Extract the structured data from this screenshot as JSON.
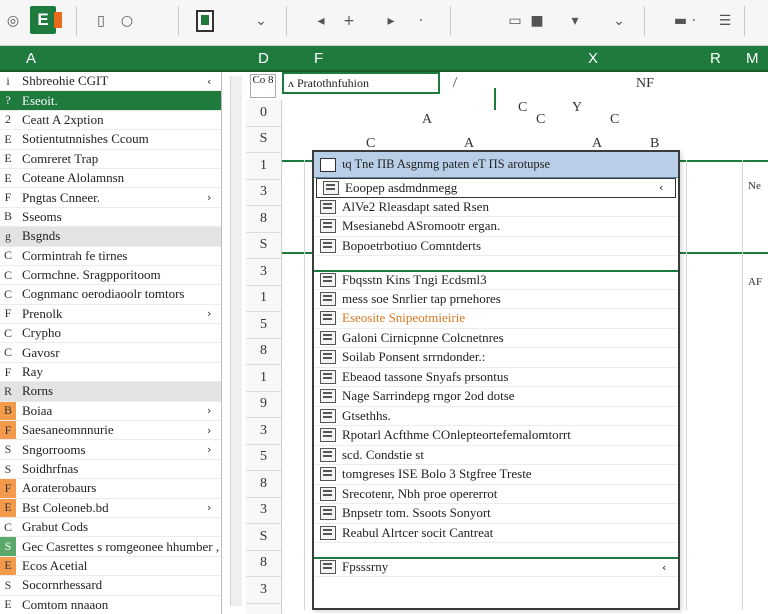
{
  "toolbar": {
    "logo": "E",
    "icons": [
      "settings-gear-icon",
      "phone-icon",
      "chevron-down-icon",
      "arrow-left-icon",
      "add-icon",
      "link-icon",
      "document-icon",
      "arrow-down-icon",
      "dash-icon",
      "menu-icon"
    ]
  },
  "column_headers": [
    "A",
    "D",
    "F",
    "X",
    "R",
    "M"
  ],
  "sidemenu": {
    "items": [
      {
        "g": "i",
        "label": "Shbreohie CGIT",
        "arrow": "‹",
        "style": "normal"
      },
      {
        "g": "?",
        "label": "Eseoit.",
        "arrow": "",
        "style": "sel"
      },
      {
        "g": "2",
        "label": "Ceatt A 2xption",
        "arrow": "",
        "style": "normal"
      },
      {
        "g": "E",
        "label": "Sotientutnnishes Ccoum",
        "arrow": "",
        "style": "normal"
      },
      {
        "g": "E",
        "label": "Comreret Trap",
        "arrow": "",
        "style": "normal"
      },
      {
        "g": "E",
        "label": "Coteane Alolamnsn",
        "arrow": "",
        "style": "normal"
      },
      {
        "g": "F",
        "label": "Pngtas Cnneer.",
        "arrow": "›",
        "style": "normal"
      },
      {
        "g": "B",
        "label": "Sseoms",
        "arrow": "",
        "style": "normal"
      },
      {
        "g": "g",
        "label": "Bsgnds",
        "arrow": "",
        "style": "grey"
      },
      {
        "g": "C",
        "label": "Cormintrah fe tirnes",
        "arrow": "",
        "style": "normal"
      },
      {
        "g": "C",
        "label": "Cormchne. Sragpporitoom",
        "arrow": "",
        "style": "normal"
      },
      {
        "g": "C",
        "label": "Cognmanc oerodiaoolr tomtors",
        "arrow": "",
        "style": "normal"
      },
      {
        "g": "F",
        "label": "Prenolk",
        "arrow": "›",
        "style": "normal"
      },
      {
        "g": "C",
        "label": "Crypho",
        "arrow": "",
        "style": "normal"
      },
      {
        "g": "C",
        "label": "Gavosr",
        "arrow": "",
        "style": "normal"
      },
      {
        "g": "F",
        "label": "Ray",
        "arrow": "",
        "style": "normal"
      },
      {
        "g": "R",
        "label": "Rorns",
        "arrow": "",
        "style": "grey"
      },
      {
        "g": "B",
        "label": "Boiaa",
        "arrow": "›",
        "style": "orange"
      },
      {
        "g": "F",
        "label": "Saesaneomnnurie",
        "arrow": "›",
        "style": "orange"
      },
      {
        "g": "S",
        "label": "Sngorrooms",
        "arrow": "›",
        "style": "normal"
      },
      {
        "g": "S",
        "label": "Soidhrfnas",
        "arrow": "",
        "style": "normal"
      },
      {
        "g": "F",
        "label": "Aoraterobaurs",
        "arrow": "",
        "style": "orange"
      },
      {
        "g": "E",
        "label": "Bst Coleoneb.bd",
        "arrow": "›",
        "style": "orange"
      },
      {
        "g": "C",
        "label": "Grabut Cods",
        "arrow": "",
        "style": "normal"
      },
      {
        "g": "S",
        "label": "Gec Casrettes s romgeonee hhumber ,",
        "arrow": "",
        "style": "green"
      },
      {
        "g": "E",
        "label": "Ecos Acetial",
        "arrow": "",
        "style": "orange"
      },
      {
        "g": "S",
        "label": "Socornrhessard",
        "arrow": "",
        "style": "normal"
      },
      {
        "g": "E",
        "label": "Comtom nnaaon",
        "arrow": "",
        "style": "normal"
      }
    ]
  },
  "sheet": {
    "namebox": "Co 8",
    "formula": "ʌ Pratothnfuhion",
    "row_numbers": [
      "0",
      "S",
      "1",
      "3",
      "8",
      "S",
      "3",
      "1",
      "5",
      "8",
      "1",
      "9",
      "3",
      "5",
      "8",
      "3",
      "S",
      "8",
      "3"
    ],
    "letters": [
      "C",
      "A",
      "Y",
      "NF",
      "C",
      "C",
      "A",
      "B",
      "C",
      "A",
      "B",
      "C",
      "C",
      "Ne",
      "AF"
    ]
  },
  "dropdown": {
    "header": "ιq Tne ΠB Asgnmg paten eT ΠS arotupse",
    "items": [
      {
        "label": "Eoopep asdmdnmegg",
        "arrow": "‹",
        "style": "boxed"
      },
      {
        "label": "AlVe2 Rleasdapt sated Rsen",
        "arrow": "",
        "style": "normal"
      },
      {
        "label": "Msesianebd ASromootr ergan.",
        "arrow": "",
        "style": "normal"
      },
      {
        "label": "Bopoetrbotiuo Comntderts",
        "arrow": "",
        "style": "normal"
      },
      {
        "label": "",
        "arrow": "",
        "style": "blank"
      },
      {
        "label": "Fbqsstn Kins Tngi Ecdsml3",
        "arrow": "",
        "style": "bigsep"
      },
      {
        "label": "mess soe Snrlier tap prnehores",
        "arrow": "",
        "style": "normal"
      },
      {
        "label": "Eseosite Snipeotmieirie",
        "arrow": "",
        "style": "orange"
      },
      {
        "label": "Galoni Cirnicpnne Colcnetnres",
        "arrow": "",
        "style": "normal"
      },
      {
        "label": "Soilab Ponsent srrndonder.:",
        "arrow": "",
        "style": "normal"
      },
      {
        "label": "Ebeaod tassone Snyafs prsontus",
        "arrow": "",
        "style": "normal"
      },
      {
        "label": "Nage Sarrindepg rngor 2od dotse",
        "arrow": "",
        "style": "normal"
      },
      {
        "label": "Gtsethhs.",
        "arrow": "",
        "style": "normal"
      },
      {
        "label": "Rpotarl Acfthme COnlepteortefemalomtorrt",
        "arrow": "",
        "style": "normal"
      },
      {
        "label": "scd. Condstie st",
        "arrow": "",
        "style": "normal"
      },
      {
        "label": "tomgreses ISE Bolo 3 Stgfree Treste",
        "arrow": "",
        "style": "normal"
      },
      {
        "label": "Srecotenr, Nbh proe opererrot",
        "arrow": "",
        "style": "normal"
      },
      {
        "label": "Bnpsetr tom. Ssoots Sonyort",
        "arrow": "",
        "style": "normal"
      },
      {
        "label": "Reabul Alrtcer socit Cantreat",
        "arrow": "",
        "style": "normal"
      },
      {
        "label": "",
        "arrow": "",
        "style": "blank"
      },
      {
        "label": "Fpsssrny",
        "arrow": "‹",
        "style": "bigsep"
      }
    ]
  }
}
